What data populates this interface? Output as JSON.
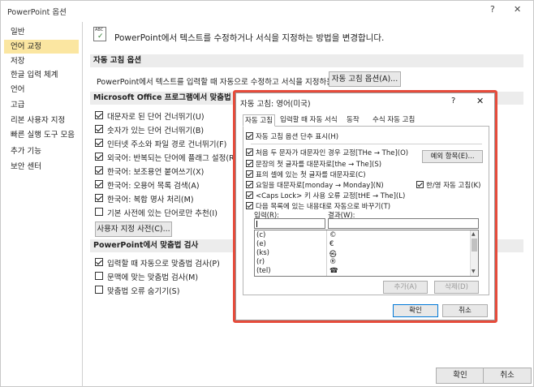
{
  "window": {
    "title": "PowerPoint 옵션",
    "help": "?",
    "close": "✕"
  },
  "sidebar": {
    "items": [
      {
        "label": "일반"
      },
      {
        "label": "언어 교정"
      },
      {
        "label": "저장"
      },
      {
        "label": "한글 입력 체계"
      },
      {
        "label": "언어"
      },
      {
        "label": "고급"
      },
      {
        "label": "리본 사용자 지정"
      },
      {
        "label": "빠른 실행 도구 모음"
      },
      {
        "label": "추가 기능"
      },
      {
        "label": "보안 센터"
      }
    ],
    "active_index": 1
  },
  "main": {
    "intro": "PowerPoint에서 텍스트를 수정하거나 서식을 지정하는 방법을 변경합니다.",
    "icon_text": "ABC",
    "autocorrect_section": {
      "header": "자동 고침 옵션",
      "text": "PowerPoint에서 텍스트를 입력할 때 자동으로 수정하고 서식을 지정하는 방법을 선택합니다.",
      "button": "자동 고침 옵션(A)..."
    },
    "office_section": {
      "header": "Microsoft Office 프로그램에서 맞춤법 검사",
      "items": [
        {
          "label": "대문자로 된 단어 건너뛰기(U)",
          "checked": true
        },
        {
          "label": "숫자가 있는 단어 건너뛰기(B)",
          "checked": true
        },
        {
          "label": "인터넷 주소와 파일 경로 건너뛰기(F)",
          "checked": true
        },
        {
          "label": "외국어: 반복되는 단어에 플래그 설정(R)",
          "checked": true
        },
        {
          "label": "한국어: 보조용언 붙여쓰기(X)",
          "checked": true
        },
        {
          "label": "한국어: 오용어 목록 검색(A)",
          "checked": true
        },
        {
          "label": "한국어: 복합 명사 처리(M)",
          "checked": true
        },
        {
          "label": "기본 사전에 있는 단어로만 추천(I)",
          "checked": false
        }
      ],
      "dictionary_button": "사용자 지정 사전(C)..."
    },
    "ppt_section": {
      "header": "PowerPoint에서 맞춤법 검사",
      "items": [
        {
          "label": "입력할 때 자동으로 맞춤법 검사(P)",
          "checked": true
        },
        {
          "label": "문맥에 맞는 맞춤법 검사(M)",
          "checked": false
        },
        {
          "label": "맞춤법 오류 숨기기(S)",
          "checked": false
        }
      ]
    }
  },
  "footer": {
    "ok": "확인",
    "cancel": "취소"
  },
  "dialog": {
    "title": "자동 고침: 영어(미국)",
    "help": "?",
    "close": "✕",
    "tabs": [
      {
        "label": "자동 고침"
      },
      {
        "label": "입력할 때 자동 서식"
      },
      {
        "label": "동작"
      },
      {
        "label": "수식 자동 고침"
      }
    ],
    "active_tab": 0,
    "show_buttons": {
      "label": "자동 고침 옵션 단추 표시(H)",
      "checked": true
    },
    "options": [
      {
        "label": "처음 두 문자가 대문자인 경우 교정[THe → The](O)",
        "checked": true
      },
      {
        "label": "문장의 첫 글자를 대문자로[the → The](S)",
        "checked": true
      },
      {
        "label": "표의 셀에 있는 첫 글자를 대문자로(C)",
        "checked": true
      },
      {
        "label": "요일을 대문자로[monday → Monday](N)",
        "checked": true
      },
      {
        "label": "<Caps Lock> 키 사용 오류 교정[tHE → The](L)",
        "checked": true
      }
    ],
    "exceptions_button": "예외 항목(E)...",
    "hanyoung": {
      "label": "한/영 자동 고침(K)",
      "checked": true
    },
    "replace_as_type": {
      "label": "다음 목록에 있는 내용대로 자동으로 바꾸기(T)",
      "checked": true
    },
    "input_label": "입력(R):",
    "result_label": "결과(W):",
    "entries": [
      {
        "key": "(c)",
        "value": "©"
      },
      {
        "key": "(e)",
        "value": "€"
      },
      {
        "key": "(ks)",
        "value": "㉿"
      },
      {
        "key": "(r)",
        "value": "®"
      },
      {
        "key": "(tel)",
        "value": "☎"
      }
    ],
    "add_button": "추가(A)",
    "delete_button": "삭제(D)",
    "ok": "확인",
    "cancel": "취소"
  }
}
